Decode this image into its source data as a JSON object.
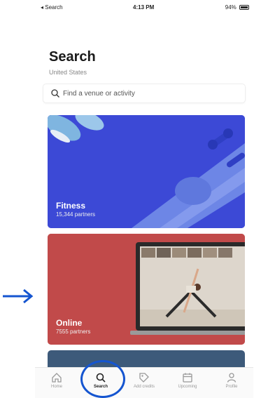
{
  "status_bar": {
    "carrier": "◂ Search",
    "time": "4:13 PM",
    "battery": "94%"
  },
  "header": {
    "title": "Search",
    "subtitle": "United States"
  },
  "search": {
    "placeholder": "Find a venue or activity"
  },
  "cards": [
    {
      "title": "Fitness",
      "subtitle": "15,344 partners"
    },
    {
      "title": "Online",
      "subtitle": "7555 partners"
    }
  ],
  "tabs": [
    {
      "label": "Home",
      "icon": "home-icon"
    },
    {
      "label": "Search",
      "icon": "search-icon",
      "active": true
    },
    {
      "label": "Add credits",
      "icon": "tag-icon"
    },
    {
      "label": "Upcoming",
      "icon": "calendar-icon"
    },
    {
      "label": "Profile",
      "icon": "person-icon"
    }
  ],
  "colors": {
    "fitness_card": "#3c49d6",
    "online_card": "#c14a4a",
    "annotation": "#1555d0"
  }
}
